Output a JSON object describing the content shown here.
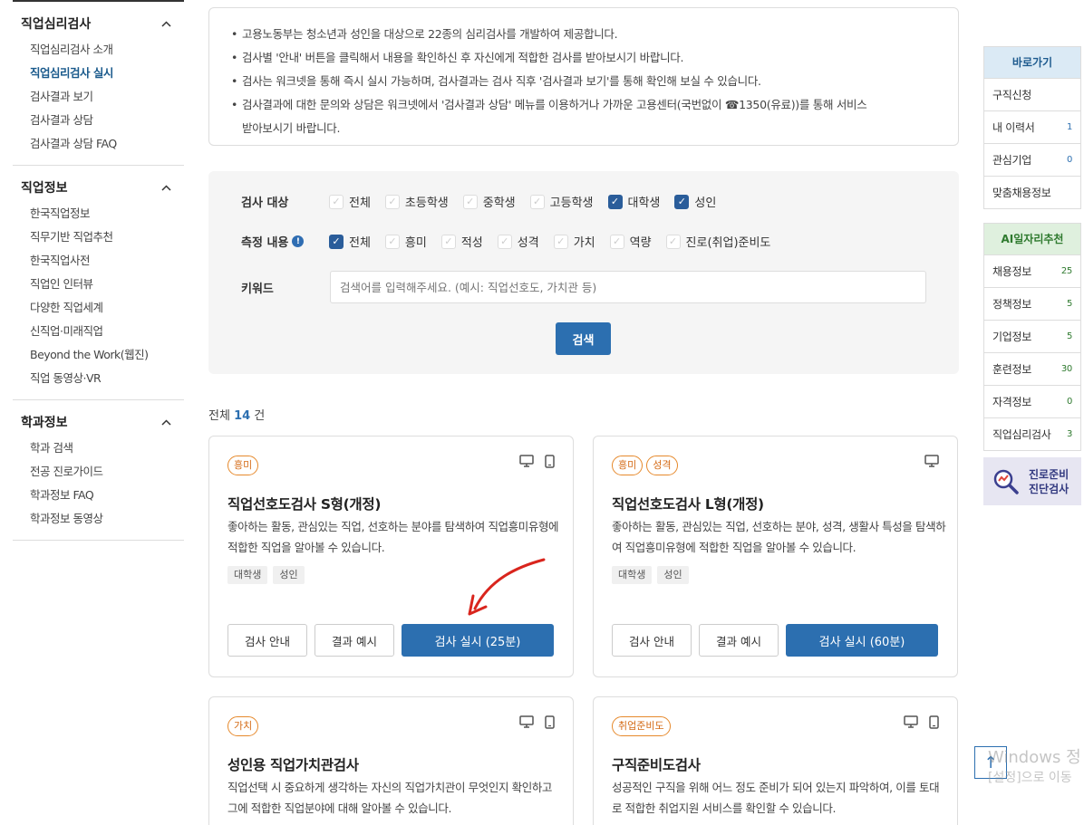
{
  "sidebar": {
    "sections": [
      {
        "title": "직업심리검사",
        "items": [
          "직업심리검사 소개",
          "직업심리검사 실시",
          "검사결과 보기",
          "검사결과 상담",
          "검사결과 상담 FAQ"
        ],
        "active_index": 1
      },
      {
        "title": "직업정보",
        "items": [
          "한국직업정보",
          "직무기반 직업추천",
          "한국직업사전",
          "직업인 인터뷰",
          "다양한 직업세계",
          "신직업·미래직업",
          "Beyond the Work(웹진)",
          "직업 동영상·VR"
        ]
      },
      {
        "title": "학과정보",
        "items": [
          "학과 검색",
          "전공 진로가이드",
          "학과정보 FAQ",
          "학과정보 동영상"
        ]
      }
    ]
  },
  "notice": {
    "lines": [
      "고용노동부는 청소년과 성인을 대상으로 22종의 심리검사를 개발하여 제공합니다.",
      "검사별 '안내' 버튼을 클릭해서 내용을 확인하신 후 자신에게 적합한 검사를 받아보시기 바랍니다.",
      "검사는 워크넷을 통해 즉시 실시 가능하며, 검사결과는 검사 직후 '검사결과 보기'를 통해 확인해 보실 수 있습니다.",
      "검사결과에 대한 문의와 상담은 워크넷에서 '검사결과 상담' 메뉴를 이용하거나 가까운 고용센터(국번없이 ☎1350(유료))를 통해 서비스",
      "받아보시기 바랍니다."
    ]
  },
  "filter": {
    "target_label": "검사 대상",
    "targets": [
      {
        "label": "전체",
        "checked": false
      },
      {
        "label": "초등학생",
        "checked": false
      },
      {
        "label": "중학생",
        "checked": false
      },
      {
        "label": "고등학생",
        "checked": false
      },
      {
        "label": "대학생",
        "checked": true
      },
      {
        "label": "성인",
        "checked": true
      }
    ],
    "measure_label": "측정 내용",
    "measures": [
      {
        "label": "전체",
        "checked": true
      },
      {
        "label": "흥미",
        "checked": false
      },
      {
        "label": "적성",
        "checked": false
      },
      {
        "label": "성격",
        "checked": false
      },
      {
        "label": "가치",
        "checked": false
      },
      {
        "label": "역량",
        "checked": false
      },
      {
        "label": "진로(취업)준비도",
        "checked": false
      }
    ],
    "keyword_label": "키워드",
    "keyword_placeholder": "검색어를 입력해주세요. (예시: 직업선호도, 가치관 등)",
    "search_button": "검색"
  },
  "results": {
    "prefix": "전체",
    "count": "14",
    "suffix": "건"
  },
  "cards": [
    {
      "tags": [
        "흥미"
      ],
      "title": "직업선호도검사 S형(개정)",
      "desc": "좋아하는 활동, 관심있는 직업, 선호하는 분야를 탐색하여 직업흥미유형에 적합한 직업을 알아볼 수 있습니다.",
      "audience": [
        "대학생",
        "성인"
      ],
      "devices": [
        "monitor-icon",
        "mobile-icon"
      ],
      "btn_guide": "검사 안내",
      "btn_example": "결과 예시",
      "btn_start": "검사 실시 (25분)"
    },
    {
      "tags": [
        "흥미",
        "성격"
      ],
      "title": "직업선호도검사 L형(개정)",
      "desc": "좋아하는 활동, 관심있는 직업, 선호하는 분야, 성격, 생활사 특성을 탐색하여 직업흥미유형에 적합한 직업을 알아볼 수 있습니다.",
      "audience": [
        "대학생",
        "성인"
      ],
      "devices": [
        "monitor-icon"
      ],
      "btn_guide": "검사 안내",
      "btn_example": "결과 예시",
      "btn_start": "검사 실시 (60분)"
    },
    {
      "tags": [
        "가치"
      ],
      "title": "성인용 직업가치관검사",
      "desc": "직업선택 시 중요하게 생각하는 자신의 직업가치관이 무엇인지 확인하고 그에 적합한 직업분야에 대해 알아볼 수 있습니다.",
      "devices": [
        "monitor-icon",
        "mobile-icon"
      ]
    },
    {
      "tags": [
        "취업준비도"
      ],
      "title": "구직준비도검사",
      "desc": "성공적인 구직을 위해 어느 정도 준비가 되어 있는지 파악하여, 이를 토대로 적합한 취업지원 서비스를 확인할 수 있습니다.",
      "devices": [
        "monitor-icon",
        "mobile-icon"
      ]
    }
  ],
  "quick_links": {
    "title": "바로가기",
    "title_bg": "#dbeaf5",
    "title_color": "#1d5a8e",
    "items": [
      {
        "label": "구직신청",
        "count": ""
      },
      {
        "label": "내 이력서",
        "count": "1"
      },
      {
        "label": "관심기업",
        "count": "0"
      },
      {
        "label": "맞춤채용정보",
        "count": ""
      }
    ],
    "count_color": "#2c6fb0"
  },
  "ai_jobs": {
    "title": "AI일자리추천",
    "title_bg": "#dff0de",
    "title_color": "#2f7a2f",
    "items": [
      {
        "label": "채용정보",
        "count": "25"
      },
      {
        "label": "정책정보",
        "count": "5"
      },
      {
        "label": "기업정보",
        "count": "5"
      },
      {
        "label": "훈련정보",
        "count": "30"
      },
      {
        "label": "자격정보",
        "count": "0"
      },
      {
        "label": "직업심리검사",
        "count": "3"
      }
    ],
    "count_color": "#2f7a2f"
  },
  "career_banner": {
    "line1": "진로준비",
    "line2": "진단검사"
  },
  "watermark": {
    "line1": "Windows 정",
    "line2": "[설정]으로 이동"
  }
}
